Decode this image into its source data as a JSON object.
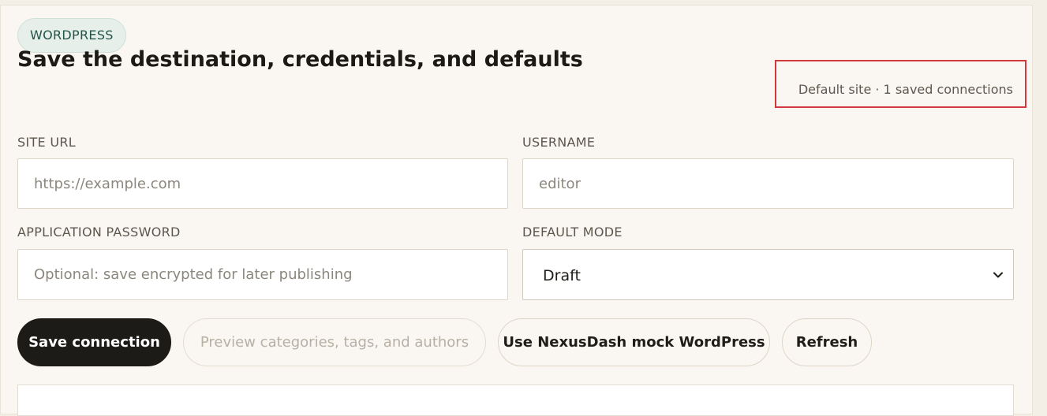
{
  "section": {
    "badge": "WORDPRESS",
    "title": "Save the destination, credentials, and defaults",
    "status": "Default site · 1 saved connections"
  },
  "form": {
    "site_url": {
      "label": "SITE URL",
      "placeholder": "https://example.com",
      "value": ""
    },
    "username": {
      "label": "USERNAME",
      "placeholder": "editor",
      "value": ""
    },
    "app_password": {
      "label": "APPLICATION PASSWORD",
      "placeholder": "Optional: save encrypted for later publishing",
      "value": ""
    },
    "default_mode": {
      "label": "DEFAULT MODE",
      "selected": "Draft"
    }
  },
  "actions": {
    "save": "Save connection",
    "preview": "Preview categories, tags, and authors",
    "mock": "Use NexusDash mock WordPress",
    "refresh": "Refresh"
  },
  "colors": {
    "primary_button": "#1d1b17",
    "highlight_border": "#d2393c",
    "badge_bg": "#e6efe9"
  }
}
